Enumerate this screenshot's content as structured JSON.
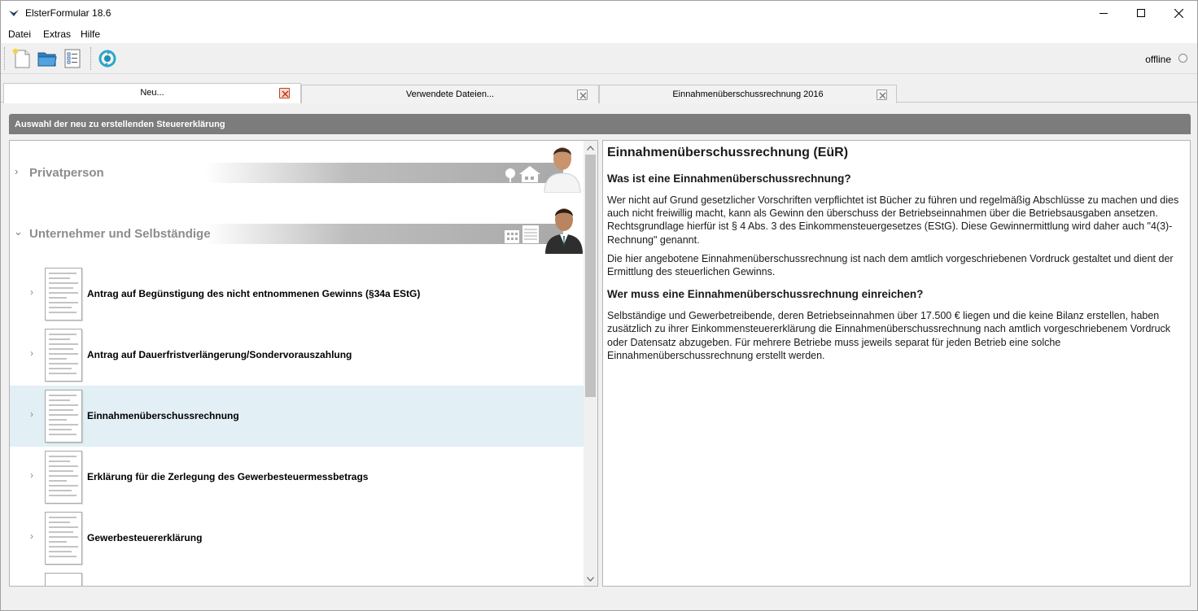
{
  "window": {
    "title": "ElsterFormular 18.6"
  },
  "menu": [
    "Datei",
    "Extras",
    "Hilfe"
  ],
  "toolbar": {
    "buttons": [
      "new-document-icon",
      "open-folder-icon",
      "form-list-icon",
      "refresh-sync-icon"
    ],
    "status_label": "offline"
  },
  "tabs": [
    {
      "label": "Neu...",
      "active": true
    },
    {
      "label": "Verwendete Dateien...",
      "active": false
    },
    {
      "label": "Einnahmenüberschussrechnung 2016",
      "active": false
    }
  ],
  "section_header": "Auswahl der neu zu erstellenden Steuererklärung",
  "categories": [
    {
      "label": "Privatperson",
      "expanded": false
    },
    {
      "label": "Unternehmer und Selbständige",
      "expanded": true
    }
  ],
  "forms": [
    {
      "label": "Antrag auf Begünstigung des nicht entnommenen Gewinns (§34a EStG)",
      "selected": false
    },
    {
      "label": "Antrag auf Dauerfristverlängerung/Sondervorauszahlung",
      "selected": false
    },
    {
      "label": "Einnahmenüberschussrechnung",
      "selected": true
    },
    {
      "label": "Erklärung für die Zerlegung des Gewerbesteuermessbetrags",
      "selected": false
    },
    {
      "label": "Gewerbesteuererklärung",
      "selected": false
    }
  ],
  "info": {
    "title": "Einnahmenüberschussrechnung (EüR)",
    "heading1": "Was ist eine Einnahmenüberschussrechnung?",
    "para1": "Wer nicht auf Grund gesetzlicher Vorschriften verpflichtet ist Bücher zu führen und regelmäßig Abschlüsse zu machen und dies auch nicht freiwillig macht, kann als Gewinn den überschuss der Betriebseinnahmen über die Betriebsausgaben ansetzen. Rechtsgrundlage hierfür ist § 4 Abs. 3 des Einkommensteuergesetzes (EStG). Diese Gewinnermittlung wird daher auch \"4(3)-Rechnung\" genannt.",
    "para2": "Die hier angebotene Einnahmenüberschussrechnung ist nach dem amtlich vorgeschriebenen Vordruck gestaltet und dient der Ermittlung des steuerlichen Gewinns.",
    "heading2": "Wer muss eine Einnahmenüberschussrechnung einreichen?",
    "para3": "Selbständige und Gewerbetreibende, deren Betriebseinnahmen über 17.500 € liegen und die keine Bilanz erstellen, haben zusätzlich zu ihrer Einkommensteuererklärung die Einnahmenüberschussrechnung nach amtlich vorgeschriebenem Vordruck oder Datensatz abzugeben. Für mehrere Betriebe muss jeweils separat für jeden Betrieb eine solche Einnahmenüberschussrechnung erstellt werden."
  }
}
